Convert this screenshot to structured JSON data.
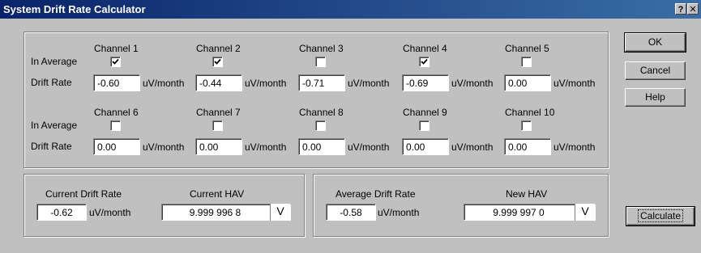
{
  "window": {
    "title": "System Drift Rate Calculator",
    "help_glyph": "?",
    "close_glyph": "✕"
  },
  "channels_panel": {
    "in_average_label": "In Average",
    "drift_rate_label": "Drift Rate",
    "unit": "uV/month",
    "channels": [
      {
        "name": "Channel 1",
        "in_average": true,
        "drift_rate": "-0.60"
      },
      {
        "name": "Channel 2",
        "in_average": true,
        "drift_rate": "-0.44"
      },
      {
        "name": "Channel 3",
        "in_average": false,
        "drift_rate": "-0.71"
      },
      {
        "name": "Channel 4",
        "in_average": true,
        "drift_rate": "-0.69"
      },
      {
        "name": "Channel 5",
        "in_average": false,
        "drift_rate": "0.00"
      },
      {
        "name": "Channel 6",
        "in_average": false,
        "drift_rate": "0.00"
      },
      {
        "name": "Channel 7",
        "in_average": false,
        "drift_rate": "0.00"
      },
      {
        "name": "Channel 8",
        "in_average": false,
        "drift_rate": "0.00"
      },
      {
        "name": "Channel 9",
        "in_average": false,
        "drift_rate": "0.00"
      },
      {
        "name": "Channel 10",
        "in_average": false,
        "drift_rate": "0.00"
      }
    ]
  },
  "current_panel": {
    "drift_rate_label": "Current Drift Rate",
    "drift_rate_value": "-0.62",
    "drift_rate_unit": "uV/month",
    "hav_label": "Current HAV",
    "hav_value": "9.999 996 8",
    "hav_unit": "V"
  },
  "average_panel": {
    "drift_rate_label": "Average Drift Rate",
    "drift_rate_value": "-0.58",
    "drift_rate_unit": "uV/month",
    "hav_label": "New HAV",
    "hav_value": "9.999 997 0",
    "hav_unit": "V"
  },
  "buttons": {
    "ok": "OK",
    "cancel": "Cancel",
    "help": "Help",
    "calculate": "Calculate"
  },
  "colors": {
    "title_bar_start": "#0a246a",
    "title_bar_end": "#3a6ea5",
    "dialog_face": "#c0c0c0"
  }
}
